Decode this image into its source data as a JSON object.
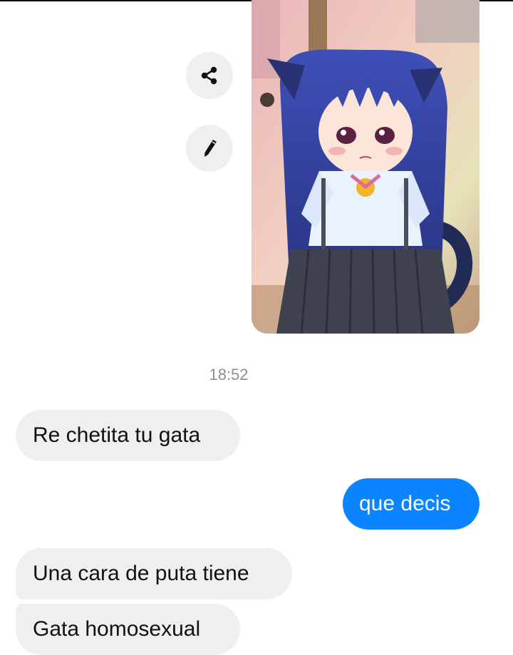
{
  "chat": {
    "timestamp": "18:52",
    "messages": [
      {
        "direction": "incoming",
        "text": "Re chetita tu gata"
      },
      {
        "direction": "outgoing",
        "text": "que decis"
      },
      {
        "direction": "incoming",
        "text": "Una cara de puta tiene"
      },
      {
        "direction": "incoming",
        "text": "Gata homosexual"
      }
    ]
  },
  "actions": {
    "share_icon": "share-icon",
    "edit_icon": "pencil-icon"
  },
  "image": {
    "description_icon": "anime-catgirl-image"
  },
  "colors": {
    "outgoing_bubble": "#0a84ff",
    "incoming_bubble": "#efefef",
    "timestamp_text": "#8e8e8e"
  }
}
